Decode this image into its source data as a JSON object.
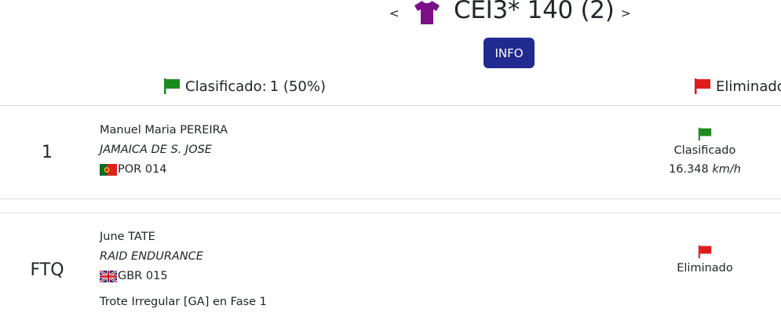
{
  "header": {
    "prev_label": "<",
    "next_label": ">",
    "title": "CEI3* 140 (2)",
    "shirt_color": "#7a0f87",
    "info_label": "INFO",
    "info_color": "#212a8f"
  },
  "summary": {
    "classified_label": "Clasificado:",
    "classified_value": "1 (50%)",
    "classified_flag_color": "#1d8a1d",
    "eliminated_label": "Eliminado",
    "eliminated_flag_color": "#e01b1b"
  },
  "results": [
    {
      "rank": "1",
      "rider": "Manuel Maria PEREIRA",
      "horse": "JAMAICA DE S. JOSE",
      "nation_flag": "portugal-flag",
      "nation": "POR 014",
      "status_flag": "green-flag",
      "status": "Clasificado",
      "speed_value": "16.348",
      "speed_unit": "km/h"
    },
    {
      "rank": "FTQ",
      "rider": "June TATE",
      "horse": "RAID ENDURANCE",
      "nation_flag": "uk-flag",
      "nation": "GBR 015",
      "status_flag": "red-flag",
      "status": "Eliminado",
      "reason": "Trote Irregular [GA] en Fase 1"
    }
  ]
}
